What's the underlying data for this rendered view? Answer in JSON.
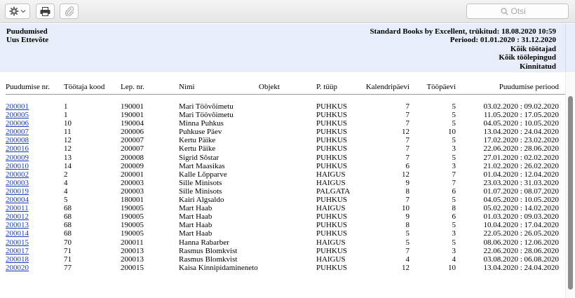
{
  "toolbar": {
    "gear_icon": "gear-icon",
    "print_icon": "printer-icon",
    "attach_icon": "paperclip-icon",
    "search_placeholder": "Otsi"
  },
  "header": {
    "left": [
      "Puudumised",
      "Uus Ettevõte"
    ],
    "right": [
      "Standard Books by Excellent, trükitud: 18.08.2020 10:59",
      "Periood: 01.01.2020 : 31.12.2020",
      "Kõik töötajad",
      "Kõik töölepingud",
      "Kinnitatud"
    ]
  },
  "columns": {
    "nr": "Puudumise nr.",
    "code": "Töötaja kood",
    "lep": "Lep. nr.",
    "name": "Nimi",
    "obj": "Objekt",
    "type": "P. tüüp",
    "cal": "Kalendripäevi",
    "work": "Tööpäevi",
    "period": "Puudumise periood"
  },
  "rows": [
    {
      "nr": "200001",
      "code": "1",
      "lep": "190001",
      "name": "Mari Töövõimetu",
      "obj": "",
      "type": "PUHKUS",
      "cal": "7",
      "work": "5",
      "period": "03.02.2020 : 09.02.2020"
    },
    {
      "nr": "200005",
      "code": "1",
      "lep": "190001",
      "name": "Mari Töövõimetu",
      "obj": "",
      "type": "PUHKUS",
      "cal": "7",
      "work": "5",
      "period": "11.05.2020 : 17.05.2020"
    },
    {
      "nr": "200006",
      "code": "10",
      "lep": "190004",
      "name": "Minna Puhkus",
      "obj": "",
      "type": "PUHKUS",
      "cal": "7",
      "work": "5",
      "period": "04.05.2020 : 10.05.2020"
    },
    {
      "nr": "200007",
      "code": "11",
      "lep": "200006",
      "name": "Puhkuse Päev",
      "obj": "",
      "type": "PUHKUS",
      "cal": "12",
      "work": "10",
      "period": "13.04.2020 : 24.04.2020"
    },
    {
      "nr": "200008",
      "code": "12",
      "lep": "200007",
      "name": "Kertu Päike",
      "obj": "",
      "type": "PUHKUS",
      "cal": "7",
      "work": "5",
      "period": "17.02.2020 : 23.02.2020"
    },
    {
      "nr": "200016",
      "code": "12",
      "lep": "200007",
      "name": "Kertu Päike",
      "obj": "",
      "type": "PUHKUS",
      "cal": "7",
      "work": "3",
      "period": "22.06.2020 : 28.06.2020"
    },
    {
      "nr": "200009",
      "code": "13",
      "lep": "200008",
      "name": "Sigrid Sõstar",
      "obj": "",
      "type": "PUHKUS",
      "cal": "7",
      "work": "5",
      "period": "27.01.2020 : 02.02.2020"
    },
    {
      "nr": "200010",
      "code": "14",
      "lep": "200009",
      "name": "Mart Maasikas",
      "obj": "",
      "type": "PUHKUS",
      "cal": "6",
      "work": "3",
      "period": "21.02.2020 : 26.02.2020"
    },
    {
      "nr": "200002",
      "code": "2",
      "lep": "200001",
      "name": "Kalle Lõpparve",
      "obj": "",
      "type": "HAIGUS",
      "cal": "12",
      "work": "7",
      "period": "01.04.2020 : 12.04.2020"
    },
    {
      "nr": "200003",
      "code": "4",
      "lep": "200003",
      "name": "Sille Minisots",
      "obj": "",
      "type": "HAIGUS",
      "cal": "9",
      "work": "7",
      "period": "23.03.2020 : 31.03.2020"
    },
    {
      "nr": "200019",
      "code": "4",
      "lep": "200003",
      "name": "Sille Minisots",
      "obj": "",
      "type": "PALGATA",
      "cal": "8",
      "work": "6",
      "period": "01.07.2020 : 08.07.2020"
    },
    {
      "nr": "200004",
      "code": "5",
      "lep": "180001",
      "name": "Kairi Algsaldo",
      "obj": "",
      "type": "PUHKUS",
      "cal": "7",
      "work": "5",
      "period": "04.05.2020 : 10.05.2020"
    },
    {
      "nr": "200011",
      "code": "68",
      "lep": "190005",
      "name": "Mart Haab",
      "obj": "",
      "type": "HAIGUS",
      "cal": "10",
      "work": "8",
      "period": "05.02.2020 : 14.02.2020"
    },
    {
      "nr": "200012",
      "code": "68",
      "lep": "190005",
      "name": "Mart Haab",
      "obj": "",
      "type": "PUHKUS",
      "cal": "9",
      "work": "6",
      "period": "01.03.2020 : 09.03.2020"
    },
    {
      "nr": "200013",
      "code": "68",
      "lep": "190005",
      "name": "Mart Haab",
      "obj": "",
      "type": "PUHKUS",
      "cal": "8",
      "work": "5",
      "period": "10.04.2020 : 17.04.2020"
    },
    {
      "nr": "200014",
      "code": "68",
      "lep": "190005",
      "name": "Mart Haab",
      "obj": "",
      "type": "PUHKUS",
      "cal": "5",
      "work": "3",
      "period": "22.05.2020 : 26.05.2020"
    },
    {
      "nr": "200015",
      "code": "70",
      "lep": "200011",
      "name": "Hanna Rabarber",
      "obj": "",
      "type": "HAIGUS",
      "cal": "5",
      "work": "5",
      "period": "08.06.2020 : 12.06.2020"
    },
    {
      "nr": "200017",
      "code": "71",
      "lep": "200013",
      "name": "Rasmus Blomkvist",
      "obj": "",
      "type": "PUHKUS",
      "cal": "7",
      "work": "3",
      "period": "22.06.2020 : 28.06.2020"
    },
    {
      "nr": "200018",
      "code": "71",
      "lep": "200013",
      "name": "Rasmus Blomkvist",
      "obj": "",
      "type": "HAIGUS",
      "cal": "4",
      "work": "4",
      "period": "03.08.2020 : 06.08.2020"
    },
    {
      "nr": "200020",
      "code": "77",
      "lep": "200015",
      "name": "Kaisa Kinnipidamineneto",
      "obj": "",
      "type": "PUHKUS",
      "cal": "12",
      "work": "10",
      "period": "13.04.2020 : 24.04.2020"
    }
  ]
}
